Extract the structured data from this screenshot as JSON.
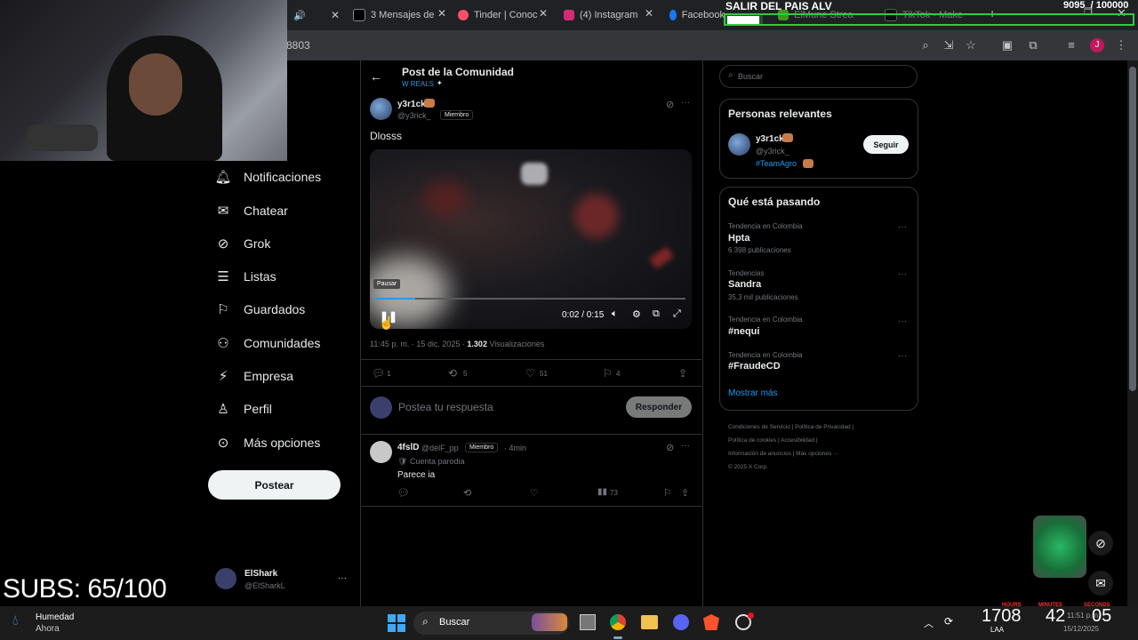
{
  "browser": {
    "tabs": [
      {
        "label": "3 Mensajes de",
        "color": "#ffffff"
      },
      {
        "label": "Tinder | Conoc",
        "color": "#fd5068"
      },
      {
        "label": "(4) Instagram",
        "color": "#d62976"
      },
      {
        "label": "Facebook",
        "color": "#1877f2"
      },
      {
        "label": "ElMune Strea",
        "color": "#53fc18"
      },
      {
        "label": "TikTok - Make",
        "color": "#ffffff"
      }
    ],
    "url_fragment": "8803"
  },
  "overlay": {
    "goal_title": "SALIR DEL PAIS ALV",
    "goal_count": "9095_/ 100000",
    "subs": "SUBS: 65/100",
    "clock_hours": "1708",
    "clock_minutes": "42",
    "clock_seconds": "05",
    "clock_labels": [
      "HOURS",
      "MINUTES",
      "SECONDS"
    ]
  },
  "nav": {
    "items": [
      {
        "label": "Notificaciones",
        "icon": "bell-icon"
      },
      {
        "label": "Chatear",
        "icon": "mail-icon"
      },
      {
        "label": "Grok",
        "icon": "grok-icon"
      },
      {
        "label": "Listas",
        "icon": "list-icon"
      },
      {
        "label": "Guardados",
        "icon": "bookmark-icon"
      },
      {
        "label": "Comunidades",
        "icon": "people-icon"
      },
      {
        "label": "Empresa",
        "icon": "lightning-icon"
      },
      {
        "label": "Perfil",
        "icon": "person-icon"
      },
      {
        "label": "Más opciones",
        "icon": "more-circle-icon"
      }
    ],
    "post_button": "Postear",
    "account_name": "ElShark",
    "account_handle": "@ElSharkL",
    "account_more": "···"
  },
  "post": {
    "header_title": "Post de la Comunidad",
    "community": "W REALS",
    "author_name": "y3r1ck",
    "author_handle": "@y3rick_",
    "author_badge": "Miembro",
    "text": "Dlosss",
    "video_time": "0:02 / 0:15",
    "video_progress": 0.13,
    "tooltip": "Pausar",
    "timestamp": "11:45 p. m. · 15 dic. 2025 ·",
    "views": "1.302",
    "views_label": "Visualizaciones",
    "replies": "1",
    "reposts": "5",
    "likes": "51",
    "bookmarks": "4",
    "reply_placeholder": "Postea tu respuesta",
    "reply_button": "Responder"
  },
  "reply": {
    "author_name": "4fslD",
    "author_handle": "@delF_pp",
    "badge": "Miembro",
    "time": "· 4min",
    "parody": "Cuenta parodia",
    "text": "Parece ia",
    "views": "73"
  },
  "sidebar": {
    "search_placeholder": "Buscar",
    "relevant_title": "Personas relevantes",
    "person_name": "y3r1ck",
    "person_handle": "@y3rick_",
    "person_tag": "#TeamAgro",
    "follow_button": "Seguir",
    "trends_title": "Qué está pasando",
    "trends": [
      {
        "meta": "Tendencia en Colombia",
        "title": "Hpta",
        "count": "6.398 publicaciones"
      },
      {
        "meta": "Tendencias",
        "title": "Sandra",
        "count": "35,3 mil publicaciones"
      },
      {
        "meta": "Tendencia en Colombia",
        "title": "#nequi",
        "count": ""
      },
      {
        "meta": "Tendencia en Colombia",
        "title": "#FraudeCD",
        "count": ""
      }
    ],
    "show_more": "Mostrar más",
    "footer": [
      "Condiciones de Servicio",
      "|",
      "Política de Privacidad",
      "|",
      "Política de cookies",
      "|",
      "Accesibilidad",
      "|",
      "Información de anuncios",
      "|",
      "Más opciones ···",
      "© 2025 X Corp."
    ]
  },
  "taskbar": {
    "weather_title": "Humedad",
    "weather_sub": "Ahora",
    "search": "Buscar",
    "time": "11:51 p.m.",
    "date": "15/12/2025",
    "lang": "LAA"
  },
  "colors": {
    "accent": "#1d9bf0",
    "goal_green": "#2ecc40",
    "clock_red": "#ff3030"
  }
}
